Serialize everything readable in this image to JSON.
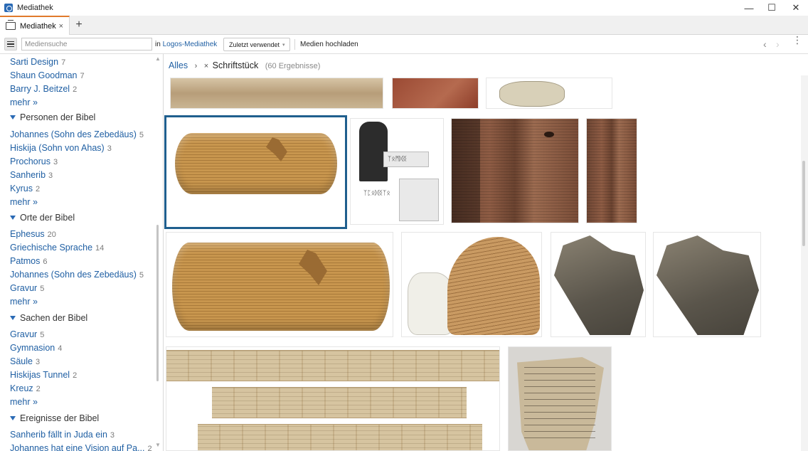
{
  "window": {
    "title": "Mediathek",
    "minimize": "—",
    "maximize": "☐",
    "close": "✕"
  },
  "tabs": {
    "active_label": "Mediathek",
    "close": "×",
    "add": "+"
  },
  "toolbar": {
    "search_placeholder": "Mediensuche",
    "scope_prefix": "in",
    "scope_link": "Logos-Mediathek",
    "recent_label": "Zuletzt verwendet",
    "recent_caret": "▾",
    "upload_label": "Medien hochladen",
    "back": "‹",
    "forward": "›",
    "more": "⋮"
  },
  "sidebar": {
    "top_items": [
      {
        "label": "Sarti Design",
        "count": "7"
      },
      {
        "label": "Shaun Goodman",
        "count": "7"
      },
      {
        "label": "Barry J. Beitzel",
        "count": "2"
      }
    ],
    "more": "mehr »",
    "sections": [
      {
        "heading": "Personen der Bibel",
        "items": [
          {
            "label": "Johannes (Sohn des Zebedäus)",
            "count": "5"
          },
          {
            "label": "Hiskija (Sohn von Ahas)",
            "count": "3"
          },
          {
            "label": "Prochorus",
            "count": "3"
          },
          {
            "label": "Sanherib",
            "count": "3"
          },
          {
            "label": "Kyrus",
            "count": "2"
          }
        ]
      },
      {
        "heading": "Orte der Bibel",
        "items": [
          {
            "label": "Ephesus",
            "count": "20"
          },
          {
            "label": "Griechische Sprache",
            "count": "14"
          },
          {
            "label": "Patmos",
            "count": "6"
          },
          {
            "label": "Johannes (Sohn des Zebedäus)",
            "count": "5"
          },
          {
            "label": "Gravur",
            "count": "5"
          }
        ]
      },
      {
        "heading": "Sachen der Bibel",
        "items": [
          {
            "label": "Gravur",
            "count": "5"
          },
          {
            "label": "Gymnasion",
            "count": "4"
          },
          {
            "label": "Säule",
            "count": "3"
          },
          {
            "label": "Hiskijas Tunnel",
            "count": "2"
          },
          {
            "label": "Kreuz",
            "count": "2"
          }
        ]
      },
      {
        "heading": "Ereignisse der Bibel",
        "items": [
          {
            "label": "Sanherib fällt in Juda ein",
            "count": "3"
          },
          {
            "label": "Johannes hat eine Vision auf Pa...",
            "count": "2"
          }
        ]
      }
    ]
  },
  "breadcrumb": {
    "root": "Alles",
    "separator": "›",
    "remove": "×",
    "current": "Schriftstück",
    "results": "(60 Ergebnisse)"
  },
  "stele_text": {
    "line1": "ᛉᛟᛗᛞᛝ",
    "line2": "ᛉᛈᛟᛞᛝᛉᛟ"
  }
}
